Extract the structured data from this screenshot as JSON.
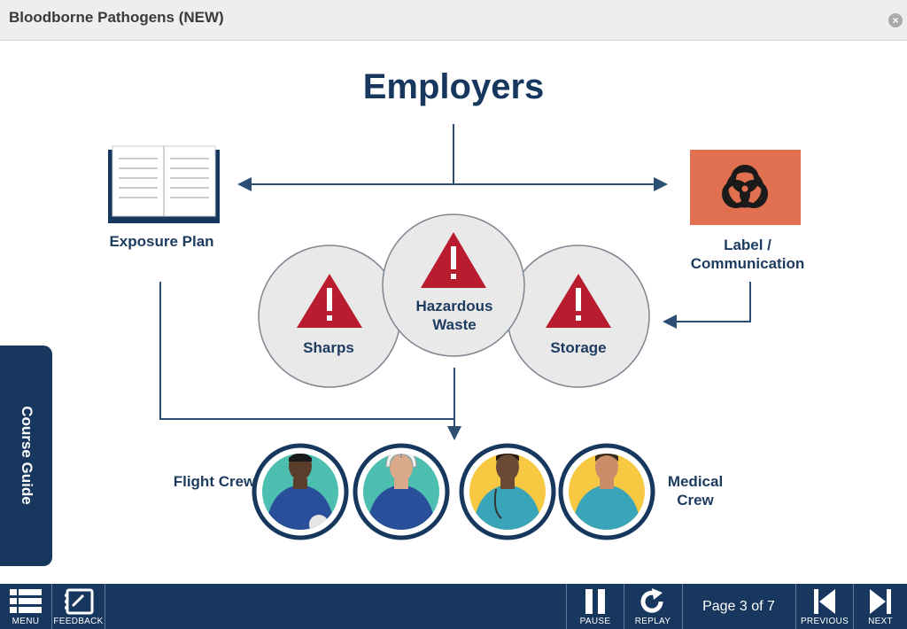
{
  "window": {
    "title": "Bloodborne Pathogens (NEW)",
    "close_glyph": "×"
  },
  "slide": {
    "heading": "Employers",
    "exposure_plan": "Exposure Plan",
    "label_communication": "Label / Communication",
    "sharps": "Sharps",
    "hazardous_waste": "Hazardous Waste",
    "storage": "Storage",
    "flight_crew": "Flight Crew",
    "medical_crew": "Medical Crew"
  },
  "course_guide": {
    "label": "Course Guide"
  },
  "toolbar": {
    "menu": "MENU",
    "feedback": "FEEDBACK",
    "pause": "PAUSE",
    "replay": "REPLAY",
    "page_indicator": "Page 3 of 7",
    "previous": "PREVIOUS",
    "next": "NEXT"
  },
  "colors": {
    "navy": "#17375e",
    "teal": "#4dbfb0",
    "yellow": "#f7c842",
    "biohazard_orange": "#e07050",
    "warning_red": "#b81c2e",
    "circle_gray": "#e9e9ea"
  },
  "icons": [
    "close-icon",
    "book-icon",
    "biohazard-icon",
    "warning-icon",
    "menu-icon",
    "feedback-icon",
    "pause-icon",
    "replay-icon",
    "previous-icon",
    "next-icon"
  ]
}
